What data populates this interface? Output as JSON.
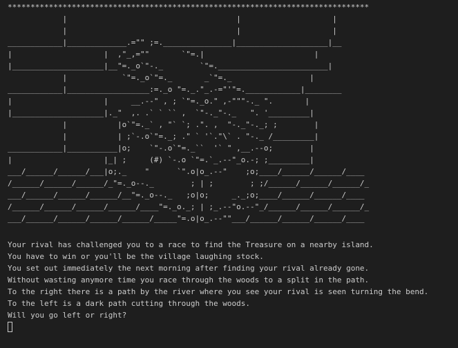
{
  "colors": {
    "background": "#1e1e1e",
    "foreground": "#cccccc"
  },
  "art_lines": [
    "*******************************************************************************",
    "            |                                     |                    |",
    "            |                                     |                    |",
    "____________|_____________.=\"\" ;=._______________|____________________|__",
    "|                    |  ,\"_,=\"\"       `\"=.|                        |",
    "|____________________|__\"=._o`\"-._        `\"=.________________________|",
    "            |            `\"=._o`\"=._       _`\"=._                 |",
    "____________|__________________:=._o \"=._.\"_.-=\"'\"=.____________|________",
    "|                    |     __.--\" , ; `\"=._o.\" ,-\"\"\"-._ \".       |",
    "|____________________|._\"  ,. .` ` `` ,  `\"-._\"-._   \". '_________|",
    "            |           |o`\"=._` , \"` `; .\". ,  \"-._\"-._; ;        |",
    "            |           | ;`-.o`\"=._; .\" ` '`.\"\\` . \"-._ /_________|",
    "____________|___________|o;    `\"-.o`\"=._``  '` \" ,__.--o;        |",
    "|                    |_| ;     (#) `-.o `\"=.`_.--\"_o.-; ;_________|",
    "___/______/______/___|o;._    \"      `\".o|o_.--\"    ;o;____/______/______/____",
    "/______/______/______/_\"=._o--._        ; | ;        ; ;/______/______/______/_",
    "___/______/______/______/__\"=._o--._   ;o|o;     _._;o;____/______/______/____",
    "/______/______/______/______/____\"=._o._; | ;_.--\"o.--\"_/______/______/______/_",
    "___/______/______/______/______/_____\"=.o|o_.--\"\"___/______/______/______/____",
    "/______/______/______/______/______/______/______/______/______/______/_____ /",
    "*******************************************************************************"
  ],
  "story_lines": [
    "Your rival has challenged you to a race to find the Treasure on a nearby island.",
    "You have to win or you'll be the village laughing stock.",
    "You set out immediately the next morning after finding your rival already gone.",
    "Without wasting anymore time you race through the woods to a split in the path.",
    "To the right there is a path by the river where you see your rival is seen turning the bend.",
    "To the left is a dark path cutting through the woods.",
    "Will you go left or right?"
  ],
  "input": {
    "value": ""
  }
}
